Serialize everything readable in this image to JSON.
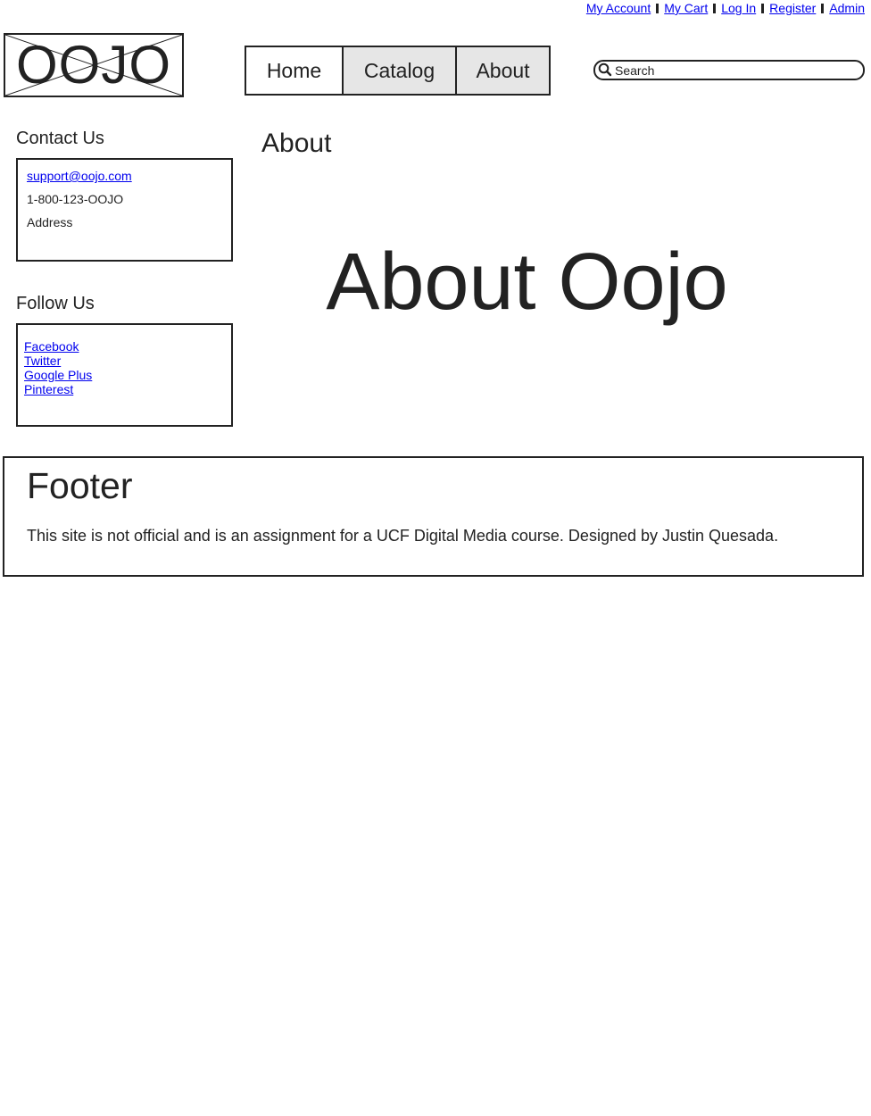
{
  "top_links": {
    "my_account": "My Account",
    "my_cart": "My Cart",
    "log_in": "Log In",
    "register": "Register",
    "admin": "Admin"
  },
  "logo": {
    "text": "OOJO"
  },
  "nav": {
    "home": "Home",
    "catalog": "Catalog",
    "about": "About"
  },
  "search": {
    "placeholder": "Search",
    "icon": "search-icon"
  },
  "sidebar": {
    "contact_title": "Contact Us",
    "contact": {
      "email": "support@oojo.com",
      "phone": "1-800-123-OOJO",
      "address": "Address"
    },
    "follow_title": "Follow Us",
    "follow_links": [
      "Facebook",
      "Twitter",
      "Google Plus",
      "Pinterest"
    ]
  },
  "main": {
    "title": "About",
    "hero": "About Oojo"
  },
  "footer": {
    "title": "Footer",
    "text": "This site is not official and is an assignment for a UCF Digital Media course. Designed by Justin Quesada."
  },
  "colors": {
    "link": "#0000ee",
    "border": "#222222",
    "tab_inactive": "#e6e6e6"
  }
}
